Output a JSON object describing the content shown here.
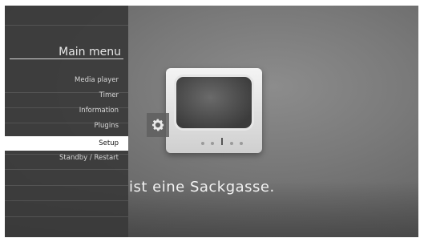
{
  "menu": {
    "title": "Main menu",
    "items": [
      {
        "label": "Media player",
        "selected": false
      },
      {
        "label": "Timer",
        "selected": false
      },
      {
        "label": "Information",
        "selected": false
      },
      {
        "label": "Plugins",
        "selected": false
      },
      {
        "label": "Setup",
        "selected": true
      },
      {
        "label": "Standby / Restart",
        "selected": false
      }
    ],
    "selected_icon": "gear-icon"
  },
  "background": {
    "message": "ist eine Sackgasse.",
    "illustration": "tv-icon"
  },
  "colors": {
    "selection": "#ffffff",
    "menu_text": "#d8d8d8",
    "panel": "#3a3a3a"
  }
}
